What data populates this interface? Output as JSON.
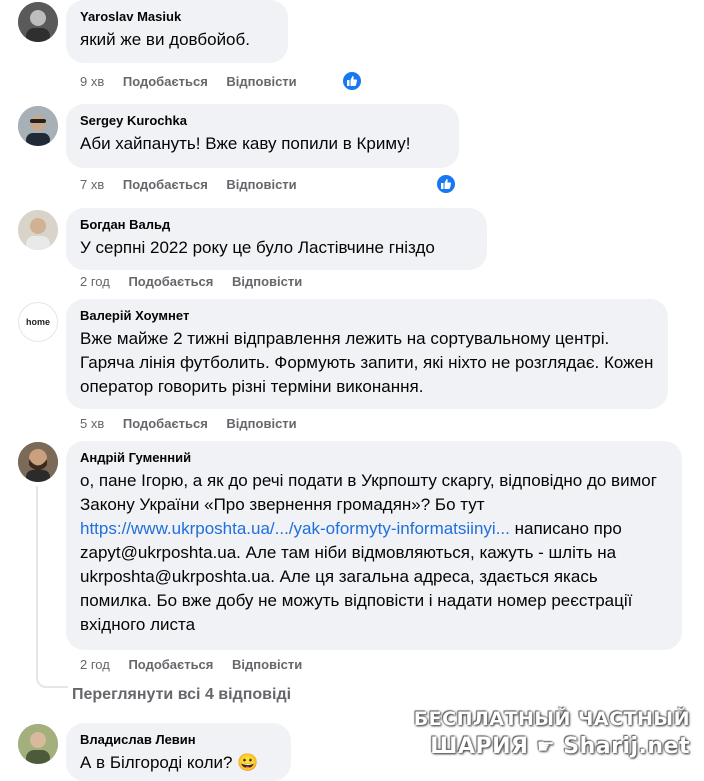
{
  "comments": [
    {
      "author": "Yaroslav Masiuk",
      "text": "який же ви довбойоб.",
      "time": "9 хв",
      "like_label": "Подобається",
      "reply_label": "Відповісти",
      "has_like_badge": true
    },
    {
      "author": "Sergey Kurochka",
      "text": "Аби хайпануть! Вже каву попили в Криму!",
      "time": "7 хв",
      "like_label": "Подобається",
      "reply_label": "Відповісти",
      "has_like_badge": true
    },
    {
      "author": "Богдан Вальд",
      "text": "У серпні 2022 року це було Ластівчине гніздо",
      "time": "2 год",
      "like_label": "Подобається",
      "reply_label": "Відповісти"
    },
    {
      "author": "Валерій Хоумнет",
      "text": "Вже майже 2 тижні відправлення лежить на сортувальному центрі. Гаряча лінія футболить. Формують запити, які ніхто не розглядає. Кожен оператор говорить різні терміни виконання.",
      "time": "5 хв",
      "like_label": "Подобається",
      "reply_label": "Відповісти",
      "avatar_text": "home"
    },
    {
      "author": "Андрій Гуменний",
      "text_before_link": "о, пане Ігорю, а як до речі подати в Укрпошту скаргу, відповідно до вимог Закону України «Про звернення громадян»? Бо тут ",
      "link": "https://www.ukrposhta.ua/.../yak-oformyty-informatsiinyi...",
      "text_after_link": " написано про zapyt@ukrposhta.ua. Але там ніби відмовляються, кажуть - шліть на ukrposhta@ukrposhta.ua. Але ця загальна адреса, здається якась помилка. Бо вже добу не можуть відповісти і надати номер реєстрації вхідного листа",
      "time": "2 год",
      "like_label": "Подобається",
      "reply_label": "Відповісти"
    },
    {
      "author": "Владислав Левин",
      "text": "А в Білгороді коли?",
      "emoji": "😀"
    }
  ],
  "view_replies": "Переглянути всі 4 відповіді",
  "watermark": {
    "line1": "БЕСПЛАТНЫЙ ЧАСТНЫЙ",
    "line2": "ШАРИЯ",
    "line2_site": "Sharij.net"
  },
  "colors": {
    "bubble": "#f0f2f5",
    "secondary_text": "#65676b",
    "link": "#216fdb",
    "like_blue": "#1877f2"
  }
}
